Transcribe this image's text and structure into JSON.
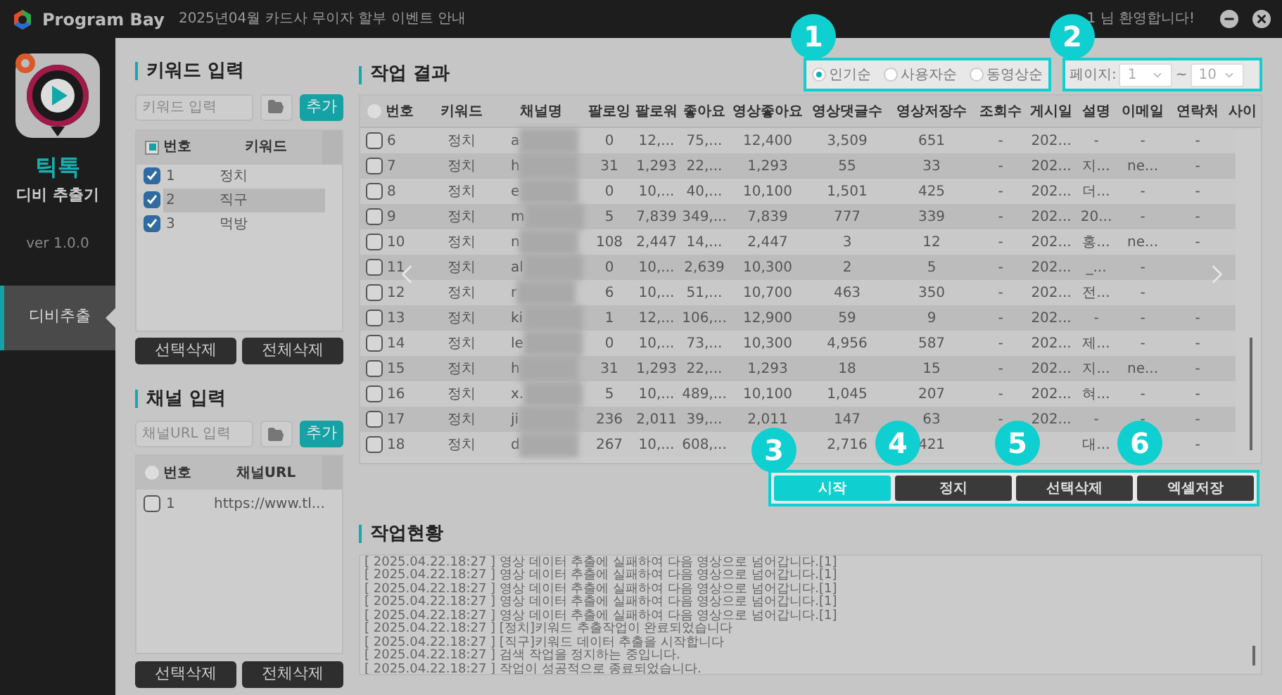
{
  "titlebar": {
    "brand": "Program Bay",
    "notice": "2025년04월 카드사 무이자 할부 이벤트 안내",
    "welcome": "1 님 환영합니다!"
  },
  "sidebar": {
    "app_name": "틱톡",
    "app_subtitle": "디비 추출기",
    "version": "ver 1.0.0",
    "items": [
      {
        "label": "디비추출",
        "selected": true
      }
    ]
  },
  "keyword_panel": {
    "title": "키워드 입력",
    "placeholder": "키워드 입력",
    "add": "추가",
    "columns": [
      "번호",
      "키워드"
    ],
    "header_checked": true,
    "rows": [
      {
        "no": "1",
        "keyword": "정치",
        "checked": true,
        "selected": false
      },
      {
        "no": "2",
        "keyword": "직구",
        "checked": true,
        "selected": true
      },
      {
        "no": "3",
        "keyword": "먹방",
        "checked": true,
        "selected": false
      }
    ],
    "buttons": [
      "선택삭제",
      "전체삭제"
    ]
  },
  "channel_panel": {
    "title": "채널 입력",
    "header_radio": false,
    "placeholder": "채널URL 입력",
    "add": "추가",
    "columns": [
      "번호",
      "채널URL"
    ],
    "rows": [
      {
        "no": "1",
        "url": "https://www.tl...",
        "checked": false
      }
    ],
    "buttons": [
      "선택삭제",
      "전체삭제"
    ]
  },
  "results": {
    "title": "작업 결과",
    "sort_options": [
      {
        "label": "인기순",
        "selected": true
      },
      {
        "label": "사용자순",
        "selected": false
      },
      {
        "label": "동영상순",
        "selected": false
      }
    ],
    "header_radio": false,
    "page_label": "페이지:",
    "page_from": "1",
    "page_sep": "~",
    "page_to": "10",
    "columns": [
      "번호",
      "키워드",
      "채널명",
      "팔로잉",
      "팔로워",
      "좋아요",
      "영상좋아요",
      "영상댓글수",
      "영상저장수",
      "조회수",
      "게시일",
      "설명",
      "이메일",
      "연락처",
      "사이"
    ],
    "rows": [
      {
        "checked": false,
        "cells": [
          "6",
          "정치",
          "a",
          "0",
          "12,...",
          "75,...",
          "12,400",
          "3,509",
          "651",
          "-",
          "202...",
          "-",
          "-",
          "-"
        ]
      },
      {
        "checked": false,
        "cells": [
          "7",
          "정치",
          "h",
          "31",
          "1,293",
          "22,...",
          "1,293",
          "55",
          "33",
          "-",
          "202...",
          "지...",
          "ne...",
          "-"
        ]
      },
      {
        "checked": false,
        "cells": [
          "8",
          "정치",
          "e",
          "0",
          "10,...",
          "40,...",
          "10,100",
          "1,501",
          "425",
          "-",
          "202...",
          "더...",
          "-",
          "-"
        ]
      },
      {
        "checked": false,
        "cells": [
          "9",
          "정치",
          "m",
          "5",
          "7,839",
          "349,...",
          "7,839",
          "777",
          "339",
          "-",
          "202...",
          "20...",
          "-",
          "-"
        ]
      },
      {
        "checked": false,
        "cells": [
          "10",
          "정치",
          "n",
          "108",
          "2,447",
          "14,...",
          "2,447",
          "3",
          "12",
          "-",
          "202...",
          "홍...",
          "ne...",
          "-"
        ]
      },
      {
        "checked": false,
        "cells": [
          "11",
          "정치",
          "al",
          "0",
          "10,...",
          "2,639",
          "10,300",
          "2",
          "5",
          "-",
          "202...",
          "_...",
          "-"
        ]
      },
      {
        "checked": false,
        "cells": [
          "12",
          "정치",
          "r",
          "6",
          "10,...",
          "51,...",
          "10,700",
          "463",
          "350",
          "-",
          "202...",
          "전...",
          "-"
        ]
      },
      {
        "checked": false,
        "cells": [
          "13",
          "정치",
          "ki",
          "1",
          "12,...",
          "106,...",
          "12,900",
          "59",
          "9",
          "-",
          "202...",
          "-",
          "-",
          "-"
        ]
      },
      {
        "checked": false,
        "cells": [
          "14",
          "정치",
          "le",
          "0",
          "10,...",
          "73,...",
          "10,300",
          "4,956",
          "587",
          "-",
          "202...",
          "제...",
          "-",
          "-"
        ]
      },
      {
        "checked": false,
        "cells": [
          "15",
          "정치",
          "h",
          "31",
          "1,293",
          "22,...",
          "1,293",
          "18",
          "15",
          "-",
          "202...",
          "지...",
          "ne...",
          "-"
        ]
      },
      {
        "checked": false,
        "cells": [
          "16",
          "정치",
          "x.",
          "5",
          "10,...",
          "489,...",
          "10,100",
          "1,045",
          "207",
          "-",
          "202...",
          "혀...",
          "-",
          "-"
        ]
      },
      {
        "checked": false,
        "cells": [
          "17",
          "정치",
          "ji",
          "236",
          "2,011",
          "39,...",
          "2,011",
          "147",
          "63",
          "-",
          "202...",
          "-",
          "-",
          "-"
        ]
      },
      {
        "checked": false,
        "cells": [
          "18",
          "정치",
          "d",
          "267",
          "10,...",
          "608,...",
          null,
          "2,716",
          "421",
          null,
          null,
          "대...",
          null,
          "-"
        ]
      }
    ],
    "actions": [
      {
        "label": "시작",
        "kind": "primary"
      },
      {
        "label": "정지",
        "kind": "dark"
      },
      {
        "label": "선택삭제",
        "kind": "dark"
      },
      {
        "label": "엑셀저장",
        "kind": "dark"
      }
    ]
  },
  "log": {
    "title": "작업현황",
    "lines": [
      "[ 2025.04.22.18:27 ] 영상 데이터 추출에 실패하여 다음 영상으로 넘어갑니다.[1]",
      "[ 2025.04.22.18:27 ] 영상 데이터 추출에 실패하여 다음 영상으로 넘어갑니다.[1]",
      "[ 2025.04.22.18:27 ] 영상 데이터 추출에 실패하여 다음 영상으로 넘어갑니다.[1]",
      "[ 2025.04.22.18:27 ] 영상 데이터 추출에 실패하여 다음 영상으로 넘어갑니다.[1]",
      "[ 2025.04.22.18:27 ] 영상 데이터 추출에 실패하여 다음 영상으로 넘어갑니다.[1]",
      "[ 2025.04.22.18:27 ] [정치]키워드 추출작업이 완료되었습니다",
      "[ 2025.04.22.18:27 ] [직구]키워드 데이터 추출을 시작합니다",
      "[ 2025.04.22.18:27 ] 검색 작업을 정지하는 중입니다.",
      "[ 2025.04.22.18:27 ] 작업이 성공적으로 종료되었습니다."
    ]
  },
  "callouts": [
    "1",
    "2",
    "3",
    "4",
    "5",
    "6"
  ]
}
